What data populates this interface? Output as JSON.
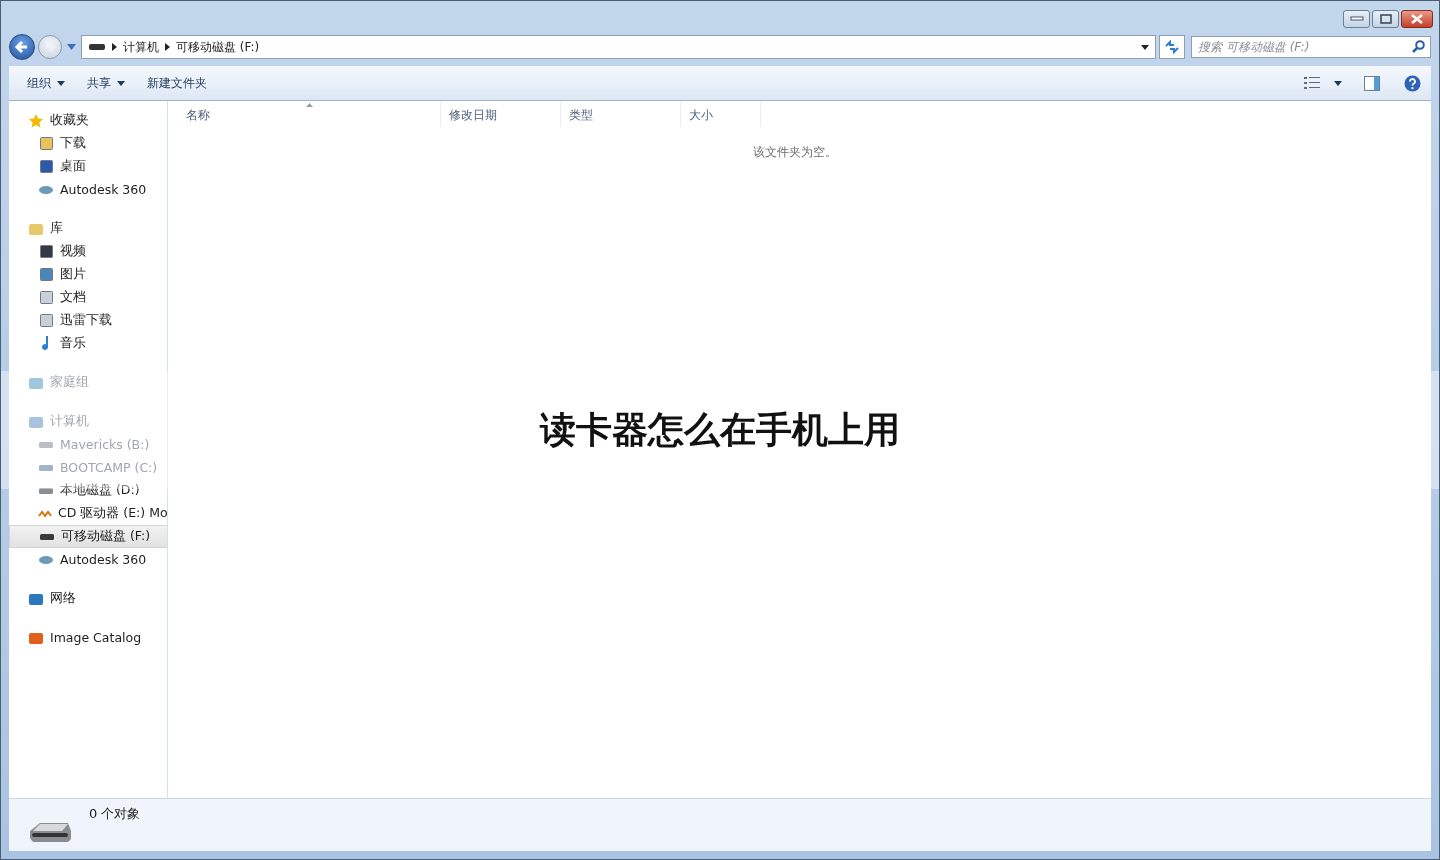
{
  "address_bar": {
    "crumbs": [
      "计算机",
      "可移动磁盘 (F:)"
    ]
  },
  "search": {
    "placeholder": "搜索 可移动磁盘 (F:)"
  },
  "toolbar": {
    "buttons": [
      {
        "label": "组织",
        "dropdown": true
      },
      {
        "label": "共享",
        "dropdown": true
      },
      {
        "label": "新建文件夹",
        "dropdown": false
      }
    ]
  },
  "sidebar": {
    "groups": [
      {
        "label": "收藏夹",
        "kind": "star",
        "dimmed": false,
        "children": [
          {
            "label": "下载",
            "kind": "download",
            "selected": false,
            "dimmed": false
          },
          {
            "label": "桌面",
            "kind": "desktop",
            "selected": false,
            "dimmed": false
          },
          {
            "label": "Autodesk 360",
            "kind": "cloud",
            "selected": false,
            "dimmed": false
          }
        ]
      },
      {
        "label": "库",
        "kind": "library",
        "dimmed": false,
        "children": [
          {
            "label": "视频",
            "kind": "video",
            "selected": false,
            "dimmed": false
          },
          {
            "label": "图片",
            "kind": "picture",
            "selected": false,
            "dimmed": false
          },
          {
            "label": "文档",
            "kind": "document",
            "selected": false,
            "dimmed": false
          },
          {
            "label": "迅雷下载",
            "kind": "document",
            "selected": false,
            "dimmed": false
          },
          {
            "label": "音乐",
            "kind": "music",
            "selected": false,
            "dimmed": false
          }
        ]
      },
      {
        "label": "家庭组",
        "kind": "homegroup",
        "dimmed": true
      },
      {
        "label": "计算机",
        "kind": "computer",
        "dimmed": true,
        "children": [
          {
            "label": "Mavericks (B:)",
            "kind": "drive",
            "selected": false,
            "dimmed": true
          },
          {
            "label": "BOOTCAMP (C:)",
            "kind": "system-drive",
            "selected": false,
            "dimmed": true
          },
          {
            "label": "本地磁盘 (D:)",
            "kind": "drive",
            "selected": false,
            "dimmed": false
          },
          {
            "label": "CD 驱动器 (E:) Mo",
            "kind": "cd",
            "selected": false,
            "dimmed": false
          },
          {
            "label": "可移动磁盘 (F:)",
            "kind": "removable",
            "selected": true,
            "dimmed": false
          },
          {
            "label": "Autodesk 360",
            "kind": "cloud",
            "selected": false,
            "dimmed": false
          }
        ]
      },
      {
        "label": "网络",
        "kind": "network",
        "dimmed": false
      },
      {
        "label": "Image Catalog",
        "kind": "catalog",
        "dimmed": false
      }
    ]
  },
  "table": {
    "columns": [
      "名称",
      "修改日期",
      "类型",
      "大小"
    ],
    "empty_message": "该文件夹为空。"
  },
  "status_bar": {
    "count": "0 个对象"
  },
  "overlay_caption": "读卡器怎么在手机上用"
}
